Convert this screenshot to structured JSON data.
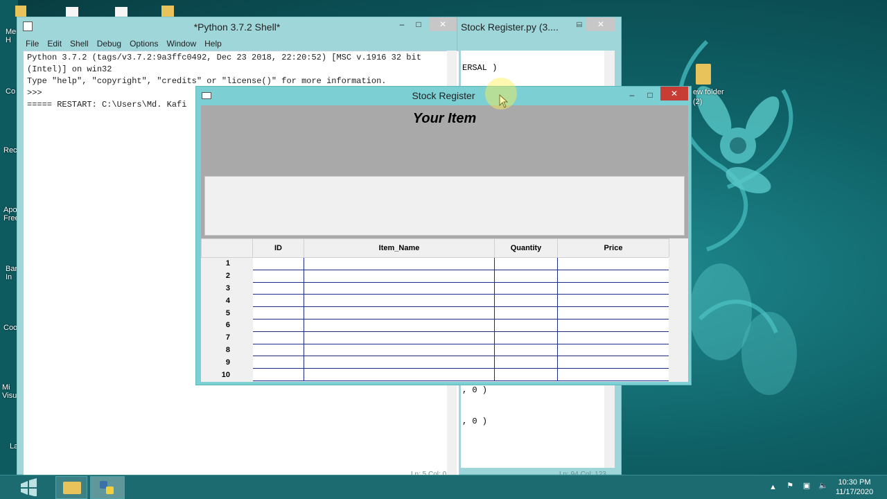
{
  "desktop": {
    "left_labels": [
      "Me\nH",
      "Co",
      "Rec",
      "Apo\nFree",
      "Bar\nIn",
      "Coo",
      "Mi\nVisu",
      "La"
    ],
    "folder_label": "ew folder\n(2)"
  },
  "shell": {
    "title": "*Python 3.7.2 Shell*",
    "menu": [
      "File",
      "Edit",
      "Shell",
      "Debug",
      "Options",
      "Window",
      "Help"
    ],
    "lines": [
      "Python 3.7.2 (tags/v3.7.2:9a3ffc0492, Dec 23 2018, 22:20:52) [MSC v.1916 32 bit",
      "(Intel)] on win32",
      "Type \"help\", \"copyright\", \"credits\" or \"license()\" for more information."
    ],
    "prompt": ">>>",
    "restart_line": "===== RESTART: C:\\Users\\Md. Kafi",
    "status": "Ln: 5   Col: 0"
  },
  "editor": {
    "title": "Stock Register.py (3....",
    "snippets": [
      "ERSAL )",
      ", 0 )",
      ", 0 )"
    ],
    "status": "Ln: 94   Col: 123"
  },
  "app": {
    "title": "Stock Register",
    "heading": "Your Item",
    "columns": [
      "ID",
      "Item_Name",
      "Quantity",
      "Price"
    ],
    "rows": [
      "1",
      "2",
      "3",
      "4",
      "5",
      "6",
      "7",
      "8",
      "9",
      "10"
    ]
  },
  "controls": {
    "minimize": "–",
    "maximize": "□",
    "close": "✕"
  },
  "tray": {
    "time": "10:30 PM",
    "date": "11/17/2020"
  },
  "colors": {
    "accent": "#1b6b70",
    "close_red": "#c83c36",
    "grid_line": "#1c2d8a"
  }
}
